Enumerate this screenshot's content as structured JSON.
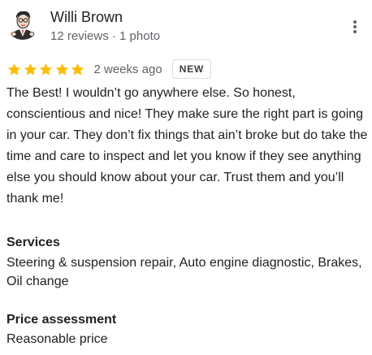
{
  "reviewer": {
    "name": "Willi Brown",
    "meta": "12 reviews · 1 photo"
  },
  "rating": {
    "value": 5,
    "max": 5,
    "star_color": "#fbbc04",
    "date": "2 weeks ago",
    "badge": "NEW"
  },
  "review": {
    "text": "The Best! I wouldn’t go anywhere else. So honest, conscientious and nice! They make sure the right part is going in your car. They don’t fix things that ain’t broke but do take the time and care to inspect and let you know if they see anything else you should know about your car. Trust them and you’ll thank me!"
  },
  "services": {
    "label": "Services",
    "value": "Steering & suspension repair, Auto engine diagnostic, Brakes, Oil change"
  },
  "price_assessment": {
    "label": "Price assessment",
    "value": "Reasonable price"
  },
  "icons": {
    "menu": "more-vert-icon",
    "star": "star-icon",
    "avatar": "avatar-image"
  },
  "colors": {
    "primary_text": "#202124",
    "secondary_text": "#5f6368",
    "badge_border": "#dadce0"
  }
}
